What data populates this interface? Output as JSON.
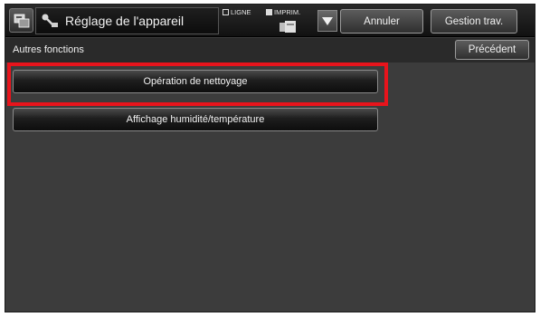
{
  "header": {
    "title": "Réglage de l'appareil",
    "mode_line": "LIGNE",
    "mode_print": "IMPRIM.",
    "cancel_label": "Annuler",
    "job_status_label": "Gestion trav."
  },
  "subheader": {
    "title": "Autres fonctions",
    "back_label": "Précédent"
  },
  "menu": {
    "items": [
      {
        "label": "Opération de nettoyage",
        "highlighted": true
      },
      {
        "label": "Affichage humidité/température",
        "highlighted": false
      }
    ]
  },
  "colors": {
    "highlight": "#e8141c",
    "background": "#3c3c3c"
  }
}
